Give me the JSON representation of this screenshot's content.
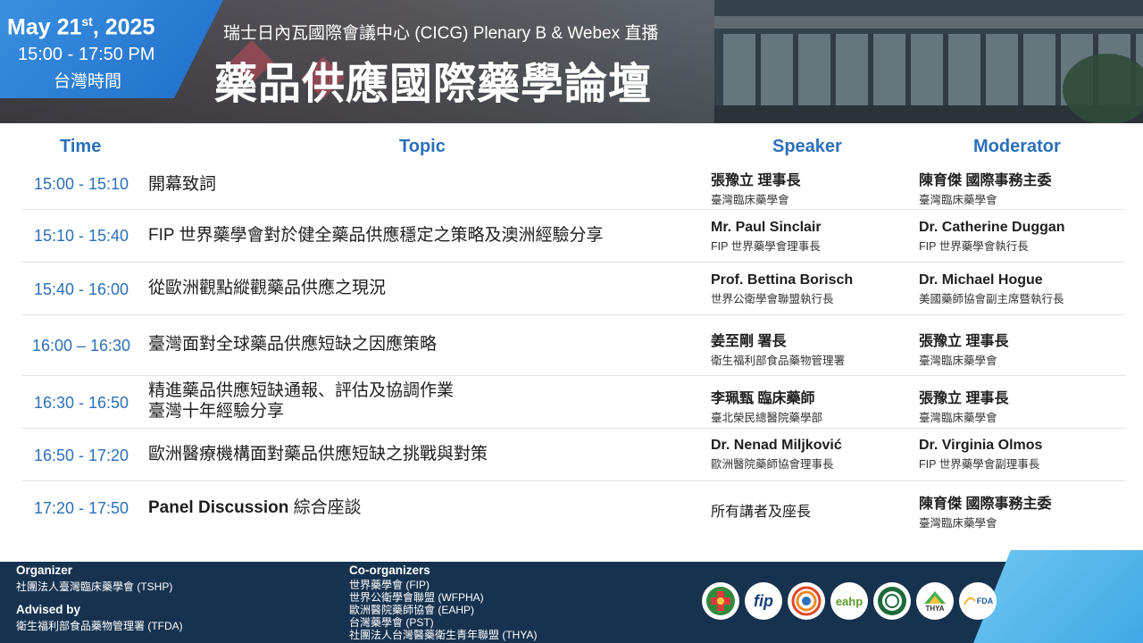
{
  "header": {
    "date_main": "May 21",
    "date_sup": "st",
    "date_year": ", 2025",
    "time_range": "15:00 - 17:50 PM",
    "time_zone": "台灣時間",
    "venue": "瑞士日內瓦國際會議中心 (CICG) Plenary B  & Webex 直播",
    "title": "藥品供應國際藥學論壇"
  },
  "columns": {
    "time": "Time",
    "topic": "Topic",
    "speaker": "Speaker",
    "moderator": "Moderator"
  },
  "agenda": [
    {
      "time": "15:00 - 15:10",
      "topic": "開幕致詞",
      "speaker_name": "張豫立 理事長",
      "speaker_affil": "臺灣臨床藥學會",
      "moderator_name": "陳育傑 國際事務主委",
      "moderator_affil": "臺灣臨床藥學會"
    },
    {
      "time": "15:10 - 15:40",
      "topic": "FIP 世界藥學會對於健全藥品供應穩定之策略及澳洲經驗分享",
      "speaker_name": "Mr. Paul Sinclair",
      "speaker_affil": "FIP 世界藥學會理事長",
      "moderator_name": "Dr. Catherine Duggan",
      "moderator_affil": "FIP 世界藥學會執行長"
    },
    {
      "time": "15:40 - 16:00",
      "topic": "從歐洲觀點縱觀藥品供應之現況",
      "speaker_name": "Prof. Bettina Borisch",
      "speaker_affil": "世界公衛學會聯盟執行長",
      "moderator_name": "Dr. Michael Hogue",
      "moderator_affil": "美國藥師協會副主席暨執行長"
    },
    {
      "time": "16:00 – 16:30",
      "topic": "臺灣面對全球藥品供應短缺之因應策略",
      "speaker_name": "姜至剛 署長",
      "speaker_affil": "衛生福利部食品藥物管理署",
      "moderator_name": "張豫立 理事長",
      "moderator_affil": "臺灣臨床藥學會"
    },
    {
      "time": "16:30 - 16:50",
      "topic": "精進藥品供應短缺通報、評估及協調作業",
      "topic_line2": "臺灣十年經驗分享",
      "speaker_name": "李珮甄 臨床藥師",
      "speaker_affil": "臺北榮民總醫院藥學部",
      "moderator_name": "張豫立 理事長",
      "moderator_affil": "臺灣臨床藥學會"
    },
    {
      "time": "16:50 - 17:20",
      "topic": "歐洲醫療機構面對藥品供應短缺之挑戰與對策",
      "speaker_name": "Dr. Nenad Miljković",
      "speaker_affil": "歐洲醫院藥師協會理事長",
      "moderator_name": "Dr. Virginia Olmos",
      "moderator_affil": "FIP 世界藥學會副理事長"
    },
    {
      "time": "17:20 - 17:50",
      "topic_bold": "Panel Discussion",
      "topic": " 綜合座談",
      "speaker_plain": "所有講者及座長",
      "moderator_name": "陳育傑 國際事務主委",
      "moderator_affil": "臺灣臨床藥學會"
    }
  ],
  "footer": {
    "organizer_label": "Organizer",
    "organizer": "社團法人臺灣臨床藥學會 (TSHP)",
    "advised_label": "Advised by",
    "advised": "衛生福利部食品藥物管理署 (TFDA)",
    "coorg_label": "Co-organizers",
    "coorgs": [
      "世界藥學會 (FIP)",
      "世界公衛學會聯盟 (WFPHA)",
      "歐洲醫院藥師協會 (EAHP)",
      "台灣藥學會 (PST)",
      "社團法人台灣醫藥衛生青年聯盟 (THYA)"
    ],
    "logos": [
      "tshp-logo",
      "fip-logo",
      "wfpha-logo",
      "eahp-logo",
      "pst-logo",
      "thya-logo",
      "tfda-logo"
    ],
    "logo_texts": {
      "fip": "fip",
      "eahp": "eahp",
      "thya": "THYA",
      "tfda": "FDA"
    }
  }
}
